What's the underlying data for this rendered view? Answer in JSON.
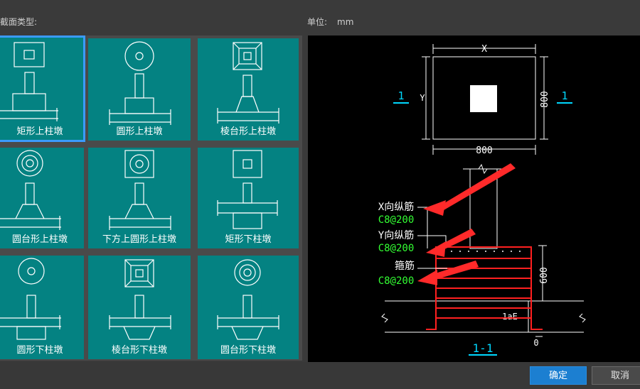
{
  "header": {
    "section_type_label": "柱截面类型:",
    "unit_label": "单位:",
    "unit_value": "mm"
  },
  "tiles": [
    {
      "label": "矩形上柱墩",
      "selected": true
    },
    {
      "label": "圆形上柱墩",
      "selected": false
    },
    {
      "label": "棱台形上柱墩",
      "selected": false
    },
    {
      "label": "圆台形上柱墩",
      "selected": false
    },
    {
      "label": "下方上圆形上柱墩",
      "selected": false
    },
    {
      "label": "矩形下柱墩",
      "selected": false
    },
    {
      "label": "圆形下柱墩",
      "selected": false
    },
    {
      "label": "棱台形下柱墩",
      "selected": false
    },
    {
      "label": "圆台形下柱墩",
      "selected": false
    }
  ],
  "preview": {
    "plan_x_label": "X",
    "plan_y_label": "Y",
    "plan_width": "800",
    "plan_height": "800",
    "section_mark": "1",
    "section_title": "1-1",
    "x_rebar_label": "X向纵筋",
    "x_rebar_value": "C8@200",
    "y_rebar_label": "Y向纵筋",
    "y_rebar_value": "C8@200",
    "stirrup_label": "箍筋",
    "stirrup_value": "C8@200",
    "height_dim": "600",
    "anchor_label": "1aE",
    "zero_dim": "0",
    "colors": {
      "rebar": "#ff2020",
      "value_text": "#33ff33",
      "dim_line": "#ffffff",
      "mark": "#00d8ff"
    }
  },
  "buttons": {
    "ok": "确定",
    "cancel": "取消"
  }
}
